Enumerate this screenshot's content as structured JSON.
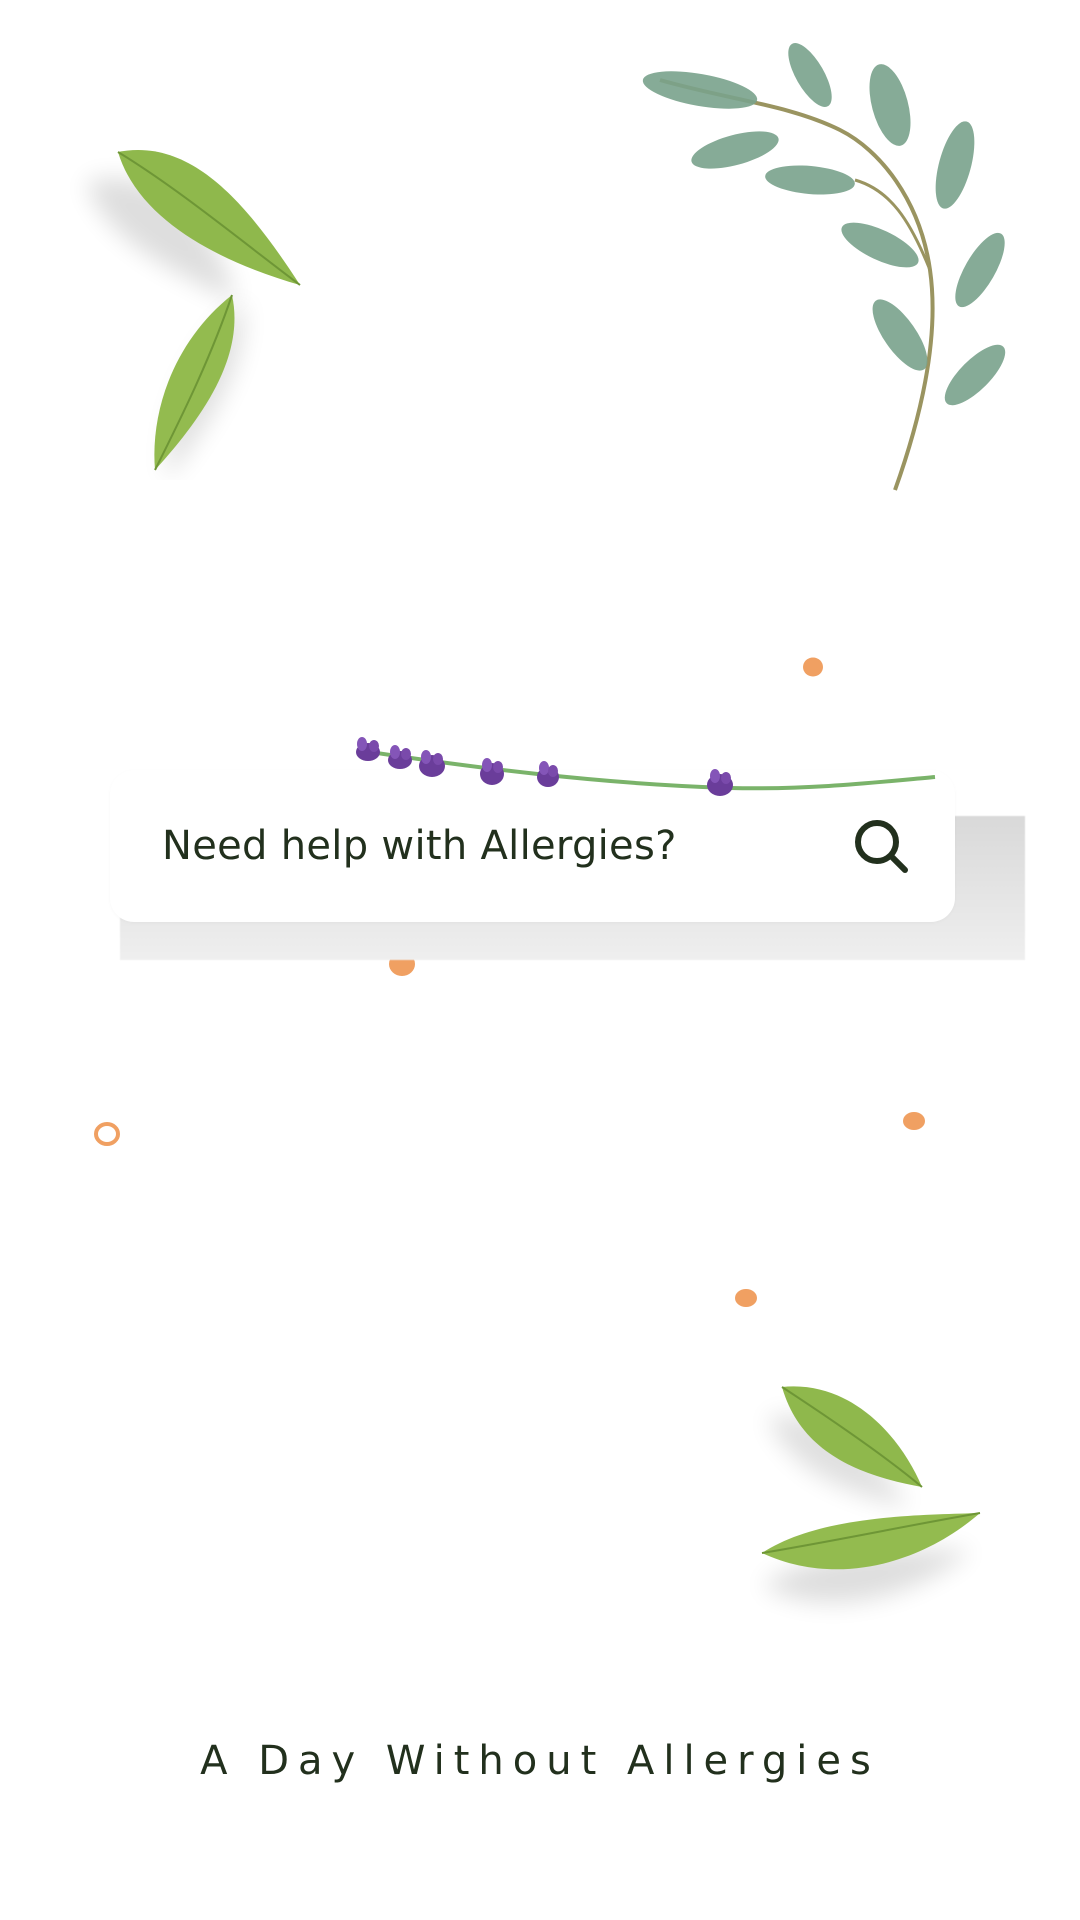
{
  "search": {
    "placeholder": "Need help with Allergies?"
  },
  "tagline": "A Day Without Allergies",
  "colors": {
    "text": "#22301d",
    "accent_dot": "#f0a062",
    "leaf_green": "#8db54a",
    "sprig_green": "#6f9c7f",
    "lavender": "#6a3d9a"
  },
  "icons": {
    "search": "search-icon"
  }
}
